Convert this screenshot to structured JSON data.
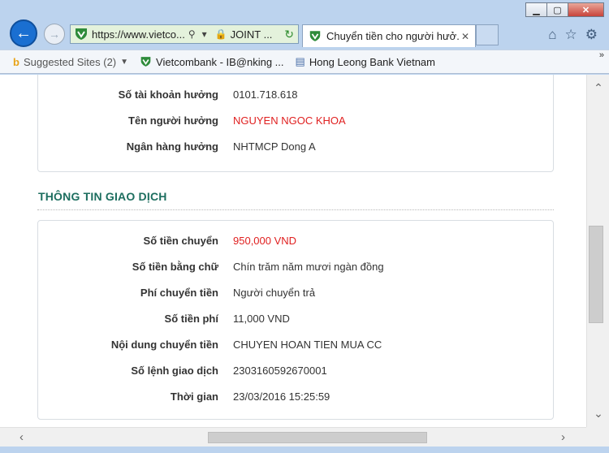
{
  "browser": {
    "address_url": "https://www.vietco...",
    "address_site": "JOINT ...",
    "tab_title": "Chuyển tiền cho người hưở...",
    "favorites": [
      {
        "label": "Suggested Sites (2)",
        "icon": "bing-icon"
      },
      {
        "label": "Vietcombank - IB@nking ...",
        "icon": "vietcombank-shield-icon"
      },
      {
        "label": "Hong Leong Bank Vietnam",
        "icon": "page-icon"
      }
    ]
  },
  "beneficiary": {
    "account_label": "Số tài khoản hưởng",
    "account_value": "0101.718.618",
    "name_label": "Tên người hưởng",
    "name_value": "NGUYEN NGOC KHOA",
    "bank_label": "Ngân hàng hưởng",
    "bank_value": "NHTMCP Dong A"
  },
  "transaction": {
    "section_title": "THÔNG TIN GIAO DỊCH",
    "amount_label": "Số tiền chuyển",
    "amount_value": "950,000 VND",
    "amount_words_label": "Số tiền bằng chữ",
    "amount_words_value": "Chín trăm năm mươi ngàn đồng",
    "fee_type_label": "Phí chuyển tiền",
    "fee_type_value": "Người chuyển trả",
    "fee_label": "Số tiền phí",
    "fee_value": "11,000 VND",
    "content_label": "Nội dung chuyển tiền",
    "content_value": "CHUYEN HOAN TIEN MUA CC",
    "order_label": "Số lệnh giao dịch",
    "order_value": "2303160592670001",
    "time_label": "Thời gian",
    "time_value": "23/03/2016 15:25:59"
  },
  "colors": {
    "accent_green": "#1d6e5f",
    "highlight_red": "#e02020",
    "ie_blue": "#1a6fd1"
  }
}
